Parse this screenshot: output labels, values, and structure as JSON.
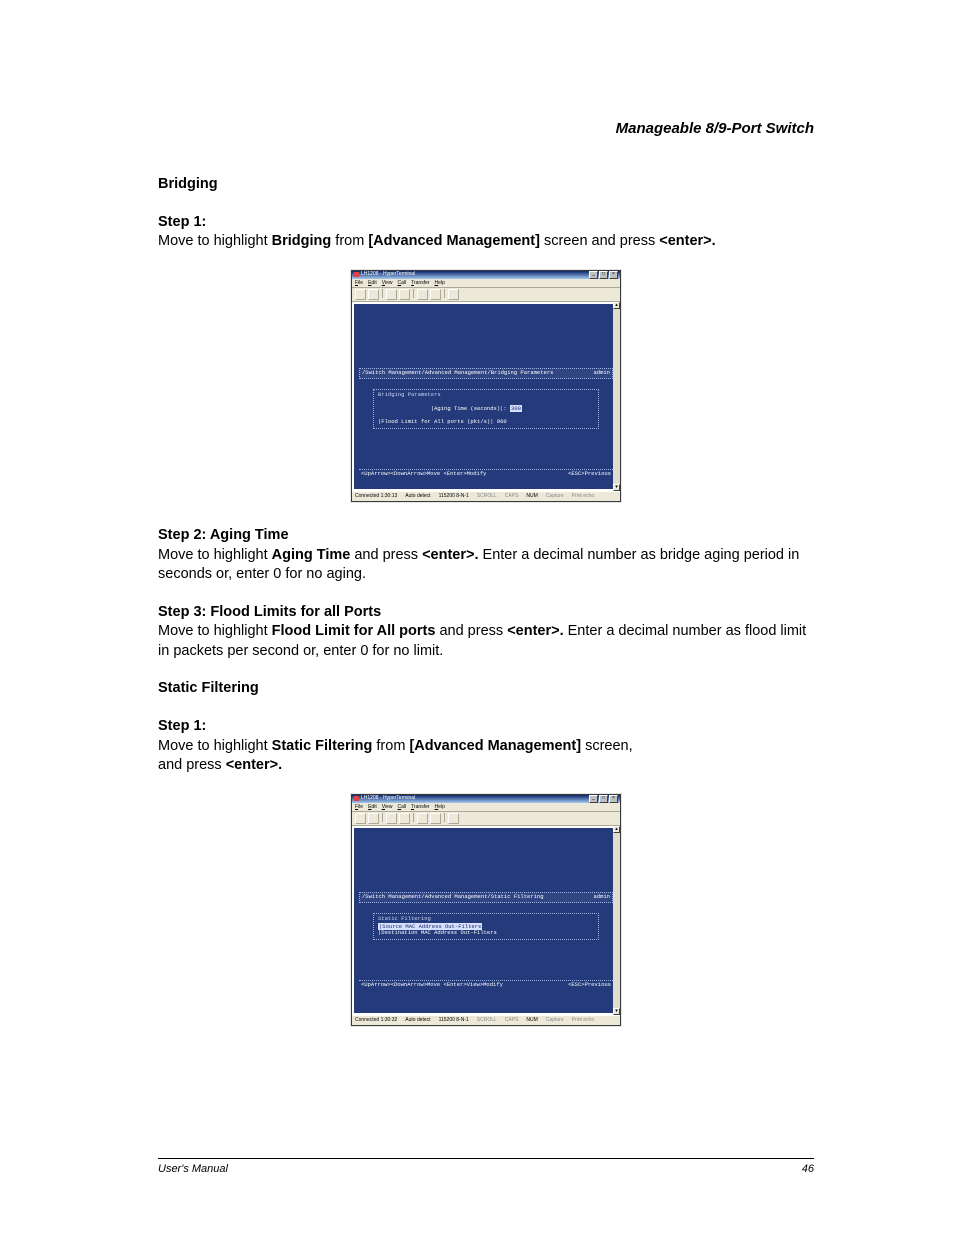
{
  "header": {
    "title": "Manageable 8/9-Port Switch"
  },
  "bridging": {
    "heading": "Bridging",
    "step1": {
      "title": "Step 1:",
      "pre": "Move to highlight ",
      "b1": "Bridging",
      "mid": " from ",
      "b2": "[Advanced Management]",
      "post": " screen and press ",
      "b3": "<enter>."
    },
    "step2": {
      "title": "Step 2: Aging Time",
      "pre": "Move to highlight ",
      "b1": "Aging Time",
      "mid": " and press ",
      "b2": "<enter>.",
      "post": " Enter a decimal number as bridge aging period in seconds or, enter 0 for no aging."
    },
    "step3": {
      "title": "Step 3: Flood Limits for all Ports",
      "pre": "Move to highlight ",
      "b1": "Flood Limit for All ports",
      "mid": " and press ",
      "b2": "<enter>.",
      "post": " Enter a decimal number as flood limit in packets per second or, enter 0 for no limit."
    }
  },
  "static_filtering": {
    "heading": "Static Filtering",
    "step1": {
      "title": "Step 1:",
      "pre": "Move to highlight ",
      "b1": "Static Filtering",
      "mid": " from ",
      "b2": "[Advanced Management]",
      "post1": " screen,",
      "post2": "and press ",
      "b3": "<enter>."
    }
  },
  "shot_common": {
    "title": "LH1208 - HyperTerminal",
    "menu": {
      "file": "File",
      "edit": "Edit",
      "view": "View",
      "call": "Call",
      "transfer": "Transfer",
      "help": "Help"
    },
    "status": {
      "connected": "Connected 1:30:13",
      "detect": "Auto detect",
      "speed": "115200 8-N-1",
      "scroll": "SCROLL",
      "caps": "CAPS",
      "num": "NUM",
      "capture": "Capture",
      "printecho": "Print echo"
    },
    "user": "admin",
    "hint_right": "<ESC>Previous"
  },
  "shot1": {
    "breadcrumb": "/Switch Management/Advanced Management/Bridging Parameters",
    "panel_title": "Bridging Parameters",
    "row1_label": "|Aging Time (seconds)|: ",
    "row1_value": "300",
    "row2": "|Flood Limit for All ports (pkt/s)| 960",
    "hint_left": "<UpArrow><DownArrow>Move  <Enter>Modify"
  },
  "shot2": {
    "breadcrumb": "/Switch Management/Advanced Management/Static Filtering",
    "panel_title": "Static Filtering",
    "row1": "|Source MAC Address Out-Filters",
    "row2": "|Destination MAC Address Out-Filters",
    "hint_left": "<UpArrow><DownArrow>Move  <Enter>View>Modify",
    "status_connected": "Connected 1:30:32"
  },
  "footer": {
    "left": "User's Manual",
    "right": "46"
  }
}
